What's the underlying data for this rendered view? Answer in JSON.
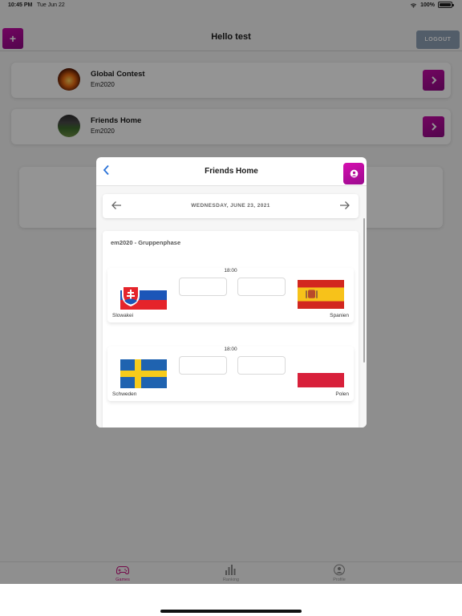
{
  "status_bar": {
    "time": "10:45 PM",
    "date": "Tue Jun 22",
    "battery": "100%"
  },
  "header": {
    "add_label": "+",
    "title": "Hello test",
    "logout_label": "LOGOUT"
  },
  "contests": [
    {
      "name": "Global Contest",
      "subtitle": "Em2020"
    },
    {
      "name": "Friends Home",
      "subtitle": "Em2020"
    }
  ],
  "tabs": [
    {
      "label": "Games",
      "icon": "gamepad-icon",
      "active": true
    },
    {
      "label": "Ranking",
      "icon": "bar-chart-icon",
      "active": false
    },
    {
      "label": "Profile",
      "icon": "user-circle-icon",
      "active": false
    }
  ],
  "modal": {
    "title": "Friends Home",
    "date": "WEDNESDAY, JUNE 23, 2021",
    "group_title": "em2020 - Gruppenphase",
    "matches": [
      {
        "time": "18:00",
        "home": "Slowakei",
        "away": "Spanien",
        "home_score": "",
        "away_score": ""
      },
      {
        "time": "18:00",
        "home": "Schweden",
        "away": "Polen",
        "home_score": "",
        "away_score": ""
      }
    ]
  },
  "colors": {
    "accent": "#b60c9a",
    "back_arrow": "#2b73d8",
    "active_tab": "#c8127f",
    "logout": "#8da0b6"
  }
}
